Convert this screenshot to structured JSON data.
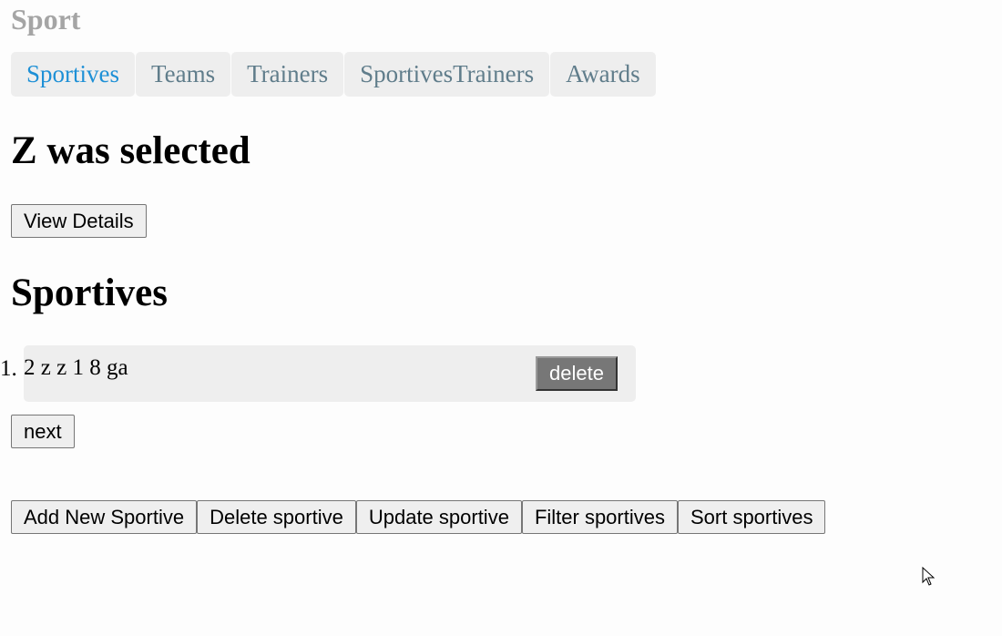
{
  "app_title": "Sport",
  "nav": {
    "tabs": [
      {
        "label": "Sportives",
        "active": true
      },
      {
        "label": "Teams",
        "active": false
      },
      {
        "label": "Trainers",
        "active": false
      },
      {
        "label": "SportivesTrainers",
        "active": false
      },
      {
        "label": "Awards",
        "active": false
      }
    ]
  },
  "selection": {
    "heading": "Z was selected",
    "view_details_label": "View Details"
  },
  "sportives": {
    "heading": "Sportives",
    "items": [
      {
        "number": "1.",
        "text": "2 z z 1 8 ga",
        "delete_label": "delete"
      }
    ],
    "next_label": "next"
  },
  "actions": {
    "add_label": "Add New Sportive",
    "delete_label": "Delete sportive",
    "update_label": "Update sportive",
    "filter_label": "Filter sportives",
    "sort_label": "Sort sportives"
  },
  "colors": {
    "title_gray": "#a5a5a5",
    "tab_bg": "#eeeeee",
    "tab_text": "#607d8b",
    "tab_active_text": "#1e90d6",
    "delete_bg": "#777777"
  },
  "icons": {
    "cursor": "mouse-pointer-icon"
  }
}
